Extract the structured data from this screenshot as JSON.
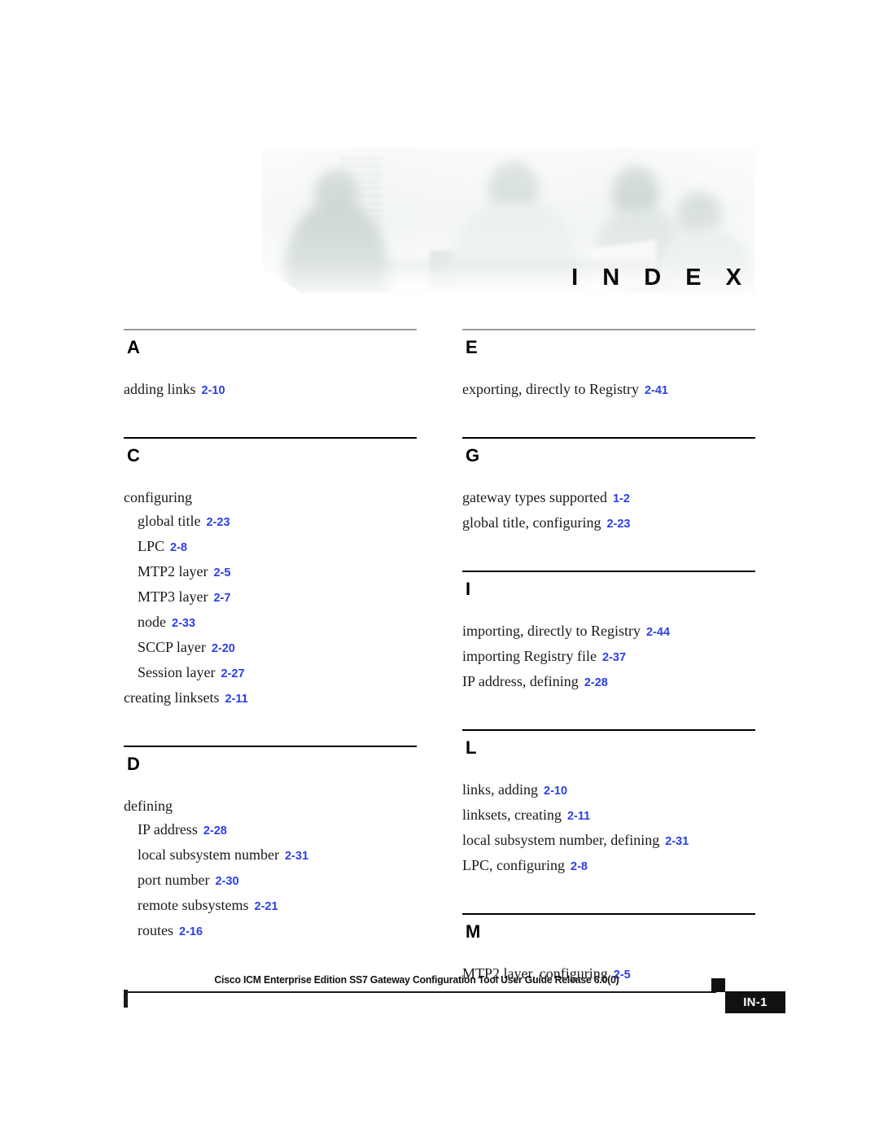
{
  "header": {
    "banner_title": "I N D E X",
    "banner_alt": "index-header-photo"
  },
  "columns": [
    {
      "id": "left",
      "sections": [
        {
          "letter": "A",
          "rule_color": "#9a9a9a",
          "entries": [
            {
              "term": "adding links",
              "page": "2-10",
              "level": 0
            }
          ]
        },
        {
          "letter": "C",
          "rule_color": "#000000",
          "entries": [
            {
              "term": "configuring",
              "page": "",
              "level": 0
            },
            {
              "term": "global title",
              "page": "2-23",
              "level": 1
            },
            {
              "term": "LPC",
              "page": "2-8",
              "level": 1
            },
            {
              "term": "MTP2 layer",
              "page": "2-5",
              "level": 1
            },
            {
              "term": "MTP3 layer",
              "page": "2-7",
              "level": 1
            },
            {
              "term": "node",
              "page": "2-33",
              "level": 1
            },
            {
              "term": "SCCP layer",
              "page": "2-20",
              "level": 1
            },
            {
              "term": "Session layer",
              "page": "2-27",
              "level": 1
            },
            {
              "term": "creating linksets",
              "page": "2-11",
              "level": 0
            }
          ]
        },
        {
          "letter": "D",
          "rule_color": "#000000",
          "entries": [
            {
              "term": "defining",
              "page": "",
              "level": 0
            },
            {
              "term": "IP address",
              "page": "2-28",
              "level": 1
            },
            {
              "term": "local subsystem number",
              "page": "2-31",
              "level": 1
            },
            {
              "term": "port number",
              "page": "2-30",
              "level": 1
            },
            {
              "term": "remote subsystems",
              "page": "2-21",
              "level": 1
            },
            {
              "term": "routes",
              "page": "2-16",
              "level": 1
            }
          ]
        }
      ]
    },
    {
      "id": "right",
      "sections": [
        {
          "letter": "E",
          "rule_color": "#9a9a9a",
          "entries": [
            {
              "term": "exporting, directly to Registry",
              "page": "2-41",
              "level": 0
            }
          ]
        },
        {
          "letter": "G",
          "rule_color": "#000000",
          "entries": [
            {
              "term": "gateway types supported",
              "page": "1-2",
              "level": 0
            },
            {
              "term": "global title, configuring",
              "page": "2-23",
              "level": 0
            }
          ]
        },
        {
          "letter": "I",
          "rule_color": "#000000",
          "entries": [
            {
              "term": "importing, directly to Registry",
              "page": "2-44",
              "level": 0
            },
            {
              "term": "importing Registry file",
              "page": "2-37",
              "level": 0
            },
            {
              "term": "IP address, defining",
              "page": "2-28",
              "level": 0
            }
          ]
        },
        {
          "letter": "L",
          "rule_color": "#000000",
          "entries": [
            {
              "term": "links, adding",
              "page": "2-10",
              "level": 0
            },
            {
              "term": "linksets, creating",
              "page": "2-11",
              "level": 0
            },
            {
              "term": "local subsystem number, defining",
              "page": "2-31",
              "level": 0
            },
            {
              "term": "LPC, configuring",
              "page": "2-8",
              "level": 0
            }
          ]
        },
        {
          "letter": "M",
          "rule_color": "#000000",
          "entries": [
            {
              "term": "MTP2 layer, configuring",
              "page": "2-5",
              "level": 0
            }
          ]
        }
      ]
    }
  ],
  "footer": {
    "title": "Cisco ICM Enterprise Edition SS7 Gateway Configuration Tool User Guide Release 6.0(0)",
    "page_number": "IN-1"
  },
  "colors": {
    "page_link": "#2b3fe8",
    "rule_black": "#000000",
    "rule_gray": "#9a9a9a",
    "footer_badge_bg": "#111111"
  }
}
